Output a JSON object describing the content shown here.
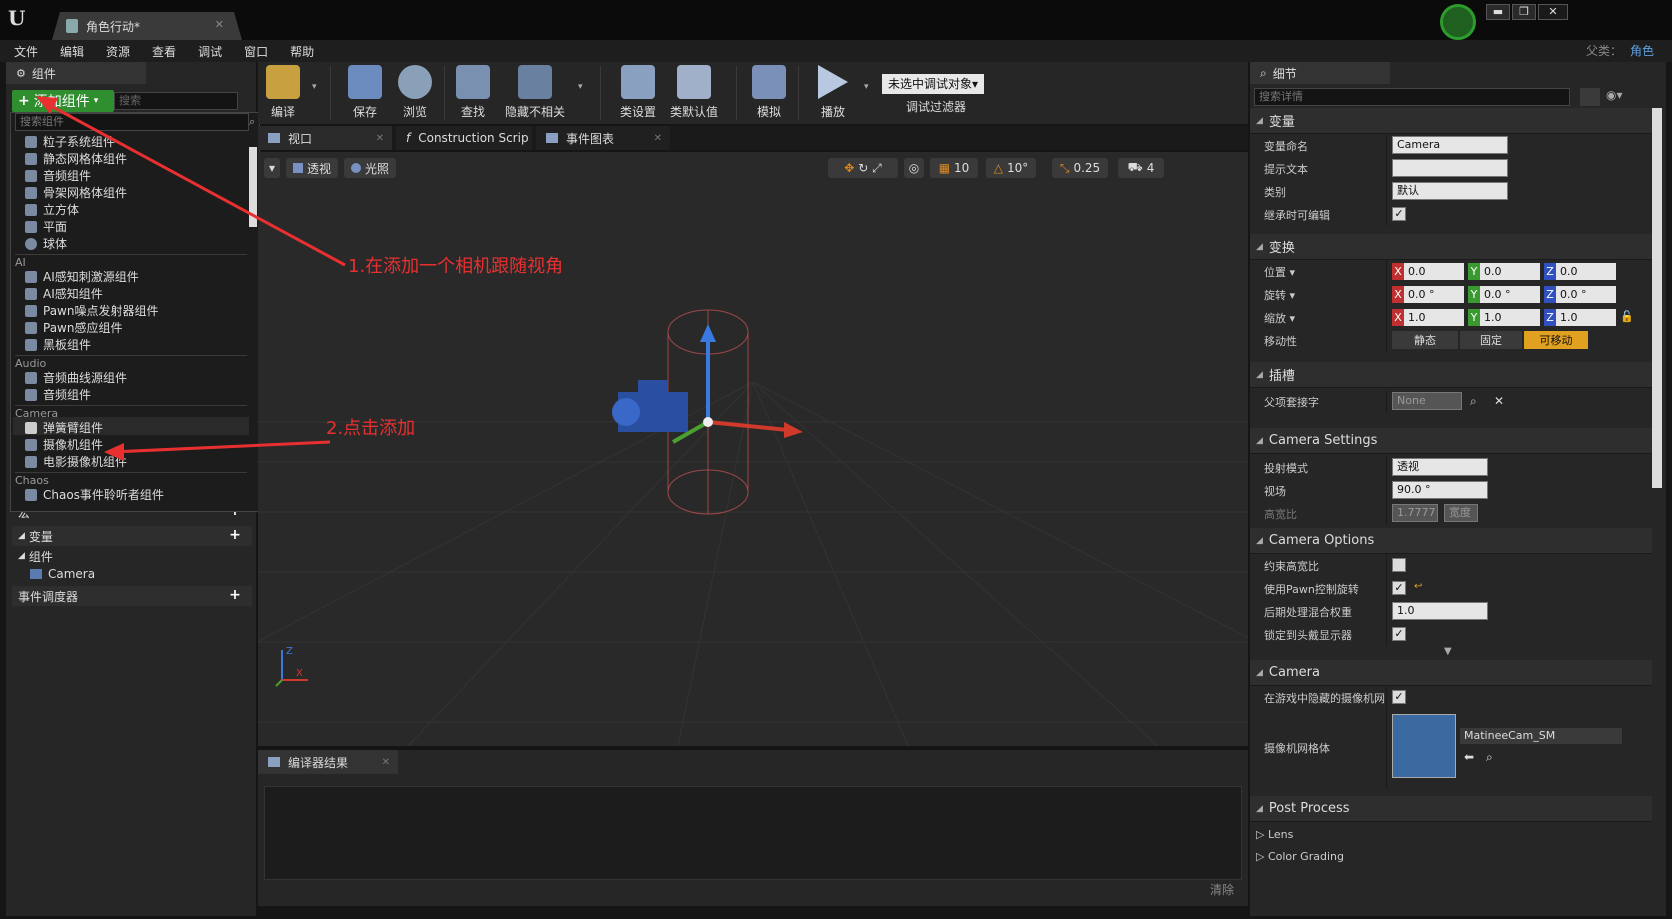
{
  "window": {
    "tab_title": "角色行动*",
    "parent_label": "父类：",
    "parent_value": "角色",
    "min": "▬",
    "max": "❐",
    "close": "✕"
  },
  "menu": [
    "文件",
    "编辑",
    "资源",
    "查看",
    "调试",
    "窗口",
    "帮助"
  ],
  "components_panel": {
    "tab": "组件",
    "add_button": "添加组件",
    "search_placeholder": "搜索",
    "dropdown_search_placeholder": "搜索组件",
    "items_top": [
      "粒子系统组件",
      "静态网格体组件",
      "音频组件",
      "骨架网格体组件",
      "立方体",
      "平面",
      "球体"
    ],
    "cat_ai": "AI",
    "items_ai": [
      "AI感知刺激源组件",
      "AI感知组件",
      "Pawn噪点发射器组件",
      "Pawn感应组件",
      "黑板组件"
    ],
    "cat_audio": "Audio",
    "items_audio": [
      "音频曲线源组件",
      "音频组件"
    ],
    "cat_camera": "Camera",
    "items_camera": [
      "弹簧臂组件",
      "摄像机组件",
      "电影摄像机组件"
    ],
    "cat_chaos": "Chaos",
    "items_chaos": [
      "Chaos事件聆听者组件"
    ],
    "macros": "宏",
    "variables": "变量",
    "components_group": "组件",
    "camera_var": "Camera",
    "event_dispatchers": "事件调度器"
  },
  "toolbar": {
    "compile": "编译",
    "save": "保存",
    "browse": "浏览",
    "find": "查找",
    "hide_unrelated": "隐藏不相关",
    "class_settings": "类设置",
    "class_defaults": "类默认值",
    "simulate": "模拟",
    "play": "播放",
    "debug_select": "未选中调试对象▾",
    "debug_filter": "调试过滤器"
  },
  "editor_tabs": [
    "视口",
    "Construction Scrip",
    "事件图表"
  ],
  "viewport": {
    "perspective": "透视",
    "lit": "光照",
    "grid_snap": "10",
    "rot_snap": "10°",
    "scale_snap": "0.25",
    "cam_speed": "4",
    "axis_x": "X",
    "axis_z": "Z"
  },
  "annotations": {
    "step1": "1.在添加一个相机跟随视角",
    "step2": "2.点击添加"
  },
  "compiler": {
    "tab": "编译器结果",
    "clear": "清除"
  },
  "details": {
    "tab": "细节",
    "search_placeholder": "搜索详情",
    "sec_variable": "变量",
    "var_name_label": "变量命名",
    "var_name": "Camera",
    "tooltip_label": "提示文本",
    "category_label": "类别",
    "category": "默认",
    "editable_label": "继承时可编辑",
    "sec_transform": "变换",
    "location_label": "位置 ▾",
    "rotation_label": "旋转 ▾",
    "scale_label": "缩放 ▾",
    "loc": [
      "0.0",
      "0.0",
      "0.0"
    ],
    "rot": [
      "0.0 °",
      "0.0 °",
      "0.0 °"
    ],
    "scale": [
      "1.0",
      "1.0",
      "1.0"
    ],
    "mobility_label": "移动性",
    "mob_static": "静态",
    "mob_stationary": "固定",
    "mob_movable": "可移动",
    "sec_socket": "插槽",
    "parent_socket_label": "父项套接字",
    "parent_socket": "None",
    "sec_camera_settings": "Camera Settings",
    "projection_label": "投射模式",
    "projection": "透视",
    "fov_label": "视场",
    "fov": "90.0 °",
    "aspect_label": "高宽比",
    "aspect": "1.7777",
    "aspect_extra": "宽度",
    "sec_camera_options": "Camera Options",
    "constrain_label": "约束高宽比",
    "pawn_rot_label": "使用Pawn控制旋转",
    "pp_weight_label": "后期处理混合权重",
    "pp_weight": "1.0",
    "lock_hmd_label": "锁定到头戴显示器",
    "sec_camera": "Camera",
    "hide_mesh_label": "在游戏中隐藏的摄像机网",
    "mesh_label": "摄像机网格体",
    "mesh_value": "MatineeCam_SM",
    "sec_post_process": "Post Process",
    "lens": "Lens",
    "color_grading": "Color Grading"
  }
}
